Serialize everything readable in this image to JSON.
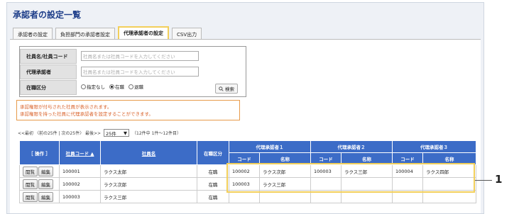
{
  "page": {
    "title": "承認者の設定一覧"
  },
  "tabs": [
    {
      "label": "承認者の設定"
    },
    {
      "label": "負担部門の承認者設定"
    },
    {
      "label": "代理承認者の設定",
      "active": true
    },
    {
      "label": "CSV出力"
    }
  ],
  "search": {
    "employee_label": "社員名/社員コード",
    "employee_placeholder": "社員名または社員コードを入力してください",
    "proxy_label": "代理承認者",
    "proxy_placeholder": "社員名または社員コードを入力してください",
    "status_label": "在職区分",
    "status_options": [
      "指定なし",
      "在職",
      "退職"
    ],
    "status_selected": "在職",
    "search_button": "検索"
  },
  "notice": {
    "line1": "承認権限が付与された社員が表示されます。",
    "line2": "承認権限を持った社員に代理承認者を設定することができます。"
  },
  "pager": {
    "nav": "<<最初  〈前の25件  |  次の25件〉  最後>>",
    "page_size": "25件",
    "summary": "（12件中 1件～12件目）"
  },
  "table": {
    "headers": {
      "ops": "［ 操作 ］",
      "code": "社員コード ▲",
      "name": "社員名",
      "status": "在職区分",
      "proxy1": "代理承認者１",
      "proxy2": "代理承認者２",
      "proxy3": "代理承認者３",
      "sub_code": "コード",
      "sub_name": "名称"
    },
    "buttons": {
      "view": "閲覧",
      "edit": "編集"
    },
    "rows": [
      {
        "code": "100001",
        "name": "ラクス太郎",
        "status": "在職",
        "p1_code": "100002",
        "p1_name": "ラクス次郎",
        "p2_code": "100003",
        "p2_name": "ラクス三郎",
        "p3_code": "100004",
        "p3_name": "ラクス四郎"
      },
      {
        "code": "100002",
        "name": "ラクス次郎",
        "status": "在職",
        "p1_code": "100003",
        "p1_name": "ラクス三郎",
        "p2_code": "",
        "p2_name": "",
        "p3_code": "",
        "p3_name": ""
      },
      {
        "code": "100003",
        "name": "ラクス三郎",
        "status": "在職",
        "p1_code": "",
        "p1_name": "",
        "p2_code": "",
        "p2_name": "",
        "p3_code": "",
        "p3_name": ""
      }
    ]
  },
  "callout": {
    "number": "1"
  },
  "colors": {
    "header_blue": "#3c6cc7",
    "highlight": "#f2cf5a",
    "notice_orange": "#d9622a",
    "title_blue": "#1f3f8a"
  }
}
